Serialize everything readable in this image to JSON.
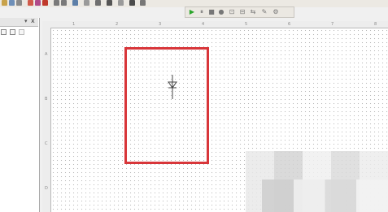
{
  "colors": {
    "highlight": "#d8363a",
    "run": "#2aa52a"
  },
  "top_toolbar_icons": [
    "open-icon",
    "save-icon",
    "print-icon",
    "cut-icon",
    "copy-icon",
    "paste-icon",
    "undo-icon",
    "redo-icon",
    "zoom-icon",
    "component-icon",
    "wire-icon",
    "help-icon"
  ],
  "sim_toolbar": {
    "icons": [
      "run-icon",
      "pause-icon",
      "stop-icon",
      "record-icon",
      "step-icon",
      "probe-icon",
      "trace-icon",
      "graph-icon",
      "camera-icon"
    ],
    "glyphs": [
      "▶",
      "⏸",
      "■",
      "●",
      "⊡",
      "⊟",
      "⇆",
      "✎",
      "⚙"
    ]
  },
  "left_panel": {
    "buttons": [
      "panel-add-button",
      "panel-settings-button"
    ],
    "close_glyph": "x"
  },
  "ruler": {
    "h_ticks": [
      "1",
      "2",
      "3",
      "4",
      "5",
      "6",
      "7",
      "8"
    ],
    "v_ticks": [
      "A",
      "B",
      "C",
      "D"
    ]
  },
  "component": {
    "name": "diode"
  }
}
